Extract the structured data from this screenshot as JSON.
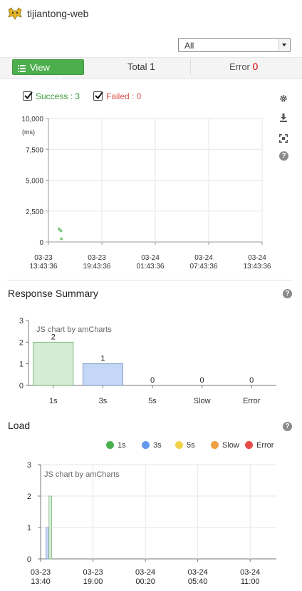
{
  "app": {
    "title": "tijiantong-web"
  },
  "filter": {
    "selected": "All"
  },
  "toolbar": {
    "view_servers_label": "View Servers",
    "total_label": "Total",
    "total_value": "1",
    "error_label": "Error",
    "error_value": "0"
  },
  "scatter_legend": {
    "success_label": "Success : 3",
    "failed_label": "Failed : 0",
    "success_color": "#3c9a3c",
    "failed_color": "#d9534f"
  },
  "sections": {
    "response_summary": "Response Summary",
    "load": "Load"
  },
  "load_legend": [
    {
      "label": "1s",
      "color": "#4caf50"
    },
    {
      "label": "3s",
      "color": "#6699ee"
    },
    {
      "label": "5s",
      "color": "#f2d04a"
    },
    {
      "label": "Slow",
      "color": "#f0a040"
    },
    {
      "label": "Error",
      "color": "#e84a4a"
    }
  ],
  "chart_data": [
    {
      "type": "scatter",
      "ylabel": "(ms)",
      "ylim": [
        0,
        10000
      ],
      "yticks": [
        "0",
        "2,500",
        "5,000",
        "7,500",
        "10,000"
      ],
      "ytick_values": [
        0,
        2500,
        5000,
        7500,
        10000
      ],
      "xticks": [
        "03-23\n13:43:36",
        "03-23\n19:43:36",
        "03-24\n01:43:36",
        "03-24\n07:43:36",
        "03-24\n13:43:36"
      ],
      "xlim_hours": [
        0,
        24
      ],
      "points_hours_ms": [
        [
          1.2,
          1050
        ],
        [
          1.4,
          900
        ],
        [
          1.45,
          250
        ]
      ],
      "point_color": "#7dc87d",
      "grid": true
    },
    {
      "type": "bar",
      "watermark": "JS chart by amCharts",
      "categories": [
        "1s",
        "3s",
        "5s",
        "Slow",
        "Error"
      ],
      "values": [
        2,
        1,
        0,
        0,
        0
      ],
      "colors": [
        "#d4ecd4",
        "#c5d7f6",
        "#fbe9a8",
        "#f8d2a6",
        "#f6c0c0"
      ],
      "strokes": [
        "#6aa86a",
        "#6b86bd",
        "#c8a838",
        "#c8863a",
        "#c85050"
      ],
      "ylim": [
        0,
        3
      ],
      "yticks": [
        "0",
        "1",
        "2",
        "3"
      ]
    },
    {
      "type": "bar",
      "watermark": "JS chart by amCharts",
      "ylim": [
        0,
        3
      ],
      "yticks": [
        "0",
        "1",
        "2",
        "3"
      ],
      "xticks": [
        "03-23\n13:40",
        "03-23\n19:00",
        "03-24\n00:20",
        "03-24\n05:40",
        "03-24\n11:00"
      ],
      "xtick_hours": [
        0,
        5.333,
        10.667,
        16,
        21.333
      ],
      "xlim_hours": [
        0,
        24
      ],
      "series": [
        {
          "name": "3s",
          "x_hours": 0.55,
          "value": 1,
          "color": "#c5d7f6",
          "stroke": "#6b86bd"
        },
        {
          "name": "1s",
          "x_hours": 0.85,
          "value": 2,
          "color": "#d4ecd4",
          "stroke": "#6aa86a"
        }
      ]
    }
  ]
}
